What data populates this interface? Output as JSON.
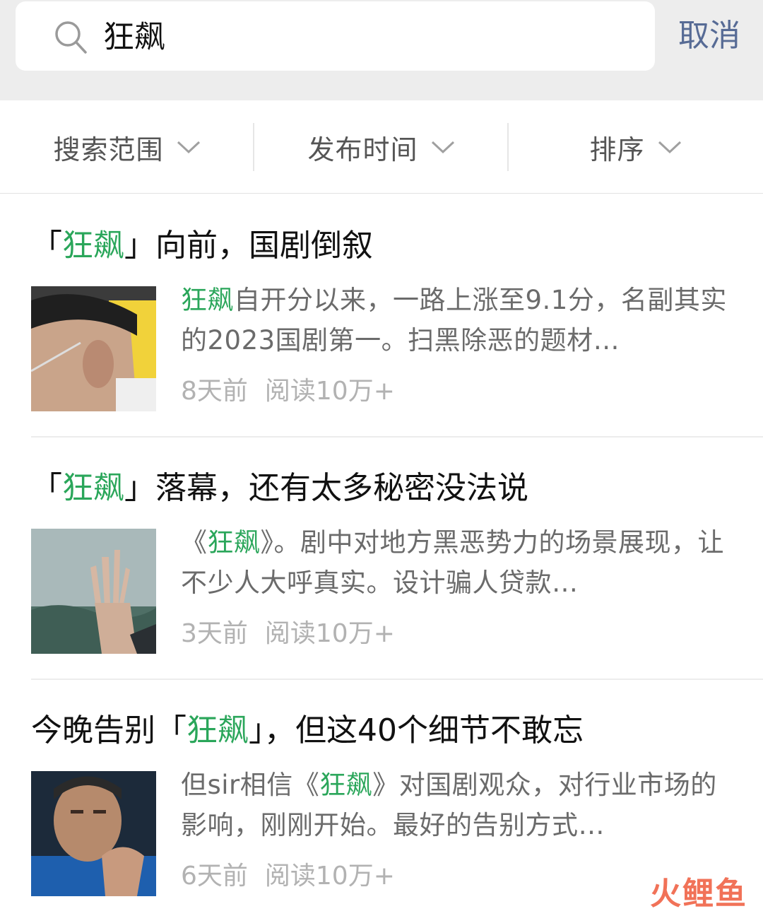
{
  "search": {
    "query": "狂飙",
    "cancel_label": "取消"
  },
  "filters": [
    {
      "label": "搜索范围"
    },
    {
      "label": "发布时间"
    },
    {
      "label": "排序"
    }
  ],
  "results": [
    {
      "title_pre": "「",
      "title_hl": "狂飙",
      "title_post": "」向前，国剧倒叙",
      "snippet_pre": "",
      "snippet_hl": "狂飙",
      "snippet_post": "自开分以来，一路上涨至9.1分，名副其实的2023国剧第一。扫黑除恶的题材…",
      "time": "8天前",
      "reads": "阅读10万+"
    },
    {
      "title_pre": "「",
      "title_hl": "狂飙",
      "title_post": "」落幕，还有太多秘密没法说",
      "snippet_pre": "《",
      "snippet_hl": "狂飙",
      "snippet_post": "》。剧中对地方黑恶势力的场景展现，让不少人大呼真实。设计骗人贷款…",
      "time": "3天前",
      "reads": "阅读10万+"
    },
    {
      "title_pre": "今晚告别「",
      "title_hl": "狂飙",
      "title_post": "」，但这40个细节不敢忘",
      "snippet_pre": "但sir相信《",
      "snippet_hl": "狂飙",
      "snippet_post": "》对国剧观众，对行业市场的影响，刚刚开始。最好的告别方式…",
      "time": "6天前",
      "reads": "阅读10万+"
    }
  ],
  "watermark": "火鲤鱼",
  "colors": {
    "highlight": "#2aa65a",
    "link": "#576b95",
    "header_bg": "#ededed"
  }
}
